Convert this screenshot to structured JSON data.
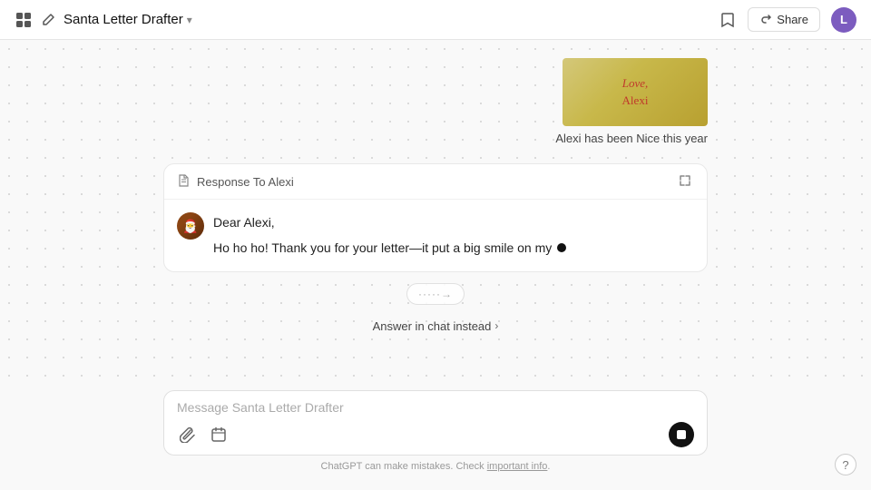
{
  "header": {
    "title": "Santa Letter Drafter",
    "chevron": "▾",
    "share_label": "Share",
    "avatar_letter": "L"
  },
  "letter_image": {
    "line1": "Love,",
    "line2": "Alexi"
  },
  "letter_caption": "Alexi has been Nice this year",
  "response": {
    "label": "Response To Alexi",
    "paragraph1": "Dear Alexi,",
    "paragraph2": "Ho ho ho! Thank you for your letter—it put a big smile on my"
  },
  "generating": {
    "text": "·····→"
  },
  "answer_in_chat": {
    "label": "Answer in chat instead",
    "chevron": "›"
  },
  "input": {
    "placeholder": "Message Santa Letter Drafter"
  },
  "footer": {
    "text": "ChatGPT can make mistakes. Check ",
    "link_text": "important info",
    "text_end": "."
  },
  "help": {
    "label": "?"
  }
}
